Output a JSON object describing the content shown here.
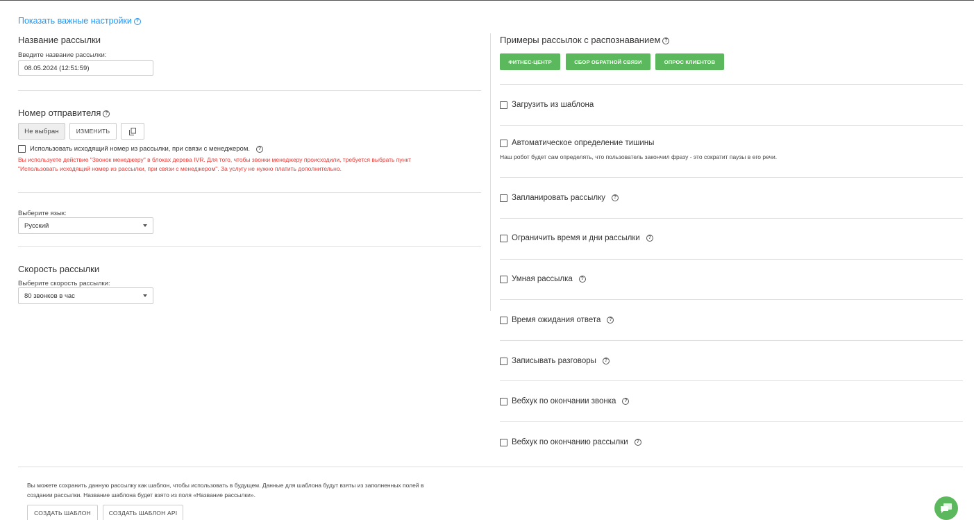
{
  "top": {
    "show_settings_link": "Показать важные настройки"
  },
  "left": {
    "name_section": {
      "heading": "Название рассылки",
      "label": "Введите название рассылки:",
      "value": "08.05.2024 (12:51:59)"
    },
    "sender_section": {
      "heading": "Номер отправителя",
      "not_selected": "Не выбран",
      "change_button": "ИЗМЕНИТЬ",
      "use_outgoing_label": "Использовать исходящий номер из рассылки, при связи с менеджером.",
      "warning_line1": "Вы используете действие \"Звонок менеджеру\" в блоках дерева IVR. Для того, чтобы звонки менеджеру происходили, требуется выбрать пункт",
      "warning_line2": "\"Использовать исходящий номер из рассылки, при связи с менеджером\". За услугу не нужно платить дополнительно."
    },
    "language_section": {
      "label": "Выберите язык:",
      "value": "Русский"
    },
    "speed_section": {
      "heading": "Скорость рассылки",
      "label": "Выберите скорость рассылки:",
      "value": "80 звонков в час"
    }
  },
  "right": {
    "examples_heading": "Примеры рассылок с распознаванием",
    "example_buttons": [
      "ФИТНЕС-ЦЕНТР",
      "СБОР ОБРАТНОЙ СВЯЗИ",
      "ОПРОС КЛИЕНТОВ"
    ],
    "options": [
      {
        "label": "Загрузить из шаблона",
        "help": false
      },
      {
        "label": "Автоматическое определение тишины",
        "help": false,
        "note": "Наш робот будет сам определять, что пользователь закончил фразу - это сократит паузы в его речи."
      },
      {
        "label": "Запланировать рассылку",
        "help": true
      },
      {
        "label": "Ограничить время и дни рассылки",
        "help": true
      },
      {
        "label": "Умная рассылка",
        "help": true
      },
      {
        "label": "Время ожидания ответа",
        "help": true
      },
      {
        "label": "Записывать разговоры",
        "help": true
      },
      {
        "label": "Вебхук по окончании звонка",
        "help": true
      },
      {
        "label": "Вебхук по окончанию рассылки",
        "help": true
      }
    ]
  },
  "bottom": {
    "note_line1": "Вы можете сохранить данную рассылку как шаблон, чтобы использовать в будущем. Данные для шаблона будут взяты из заполненных полей в",
    "note_line2": "создании рассылки. Название шаблона будет взято из поля «Название рассылки».",
    "create_template": "СОЗДАТЬ ШАБЛОН",
    "create_template_api": "СОЗДАТЬ ШАБЛОН API"
  },
  "icons": {
    "help": "help-circle-icon",
    "copy": "copy-icon",
    "chat": "chat-icon"
  }
}
